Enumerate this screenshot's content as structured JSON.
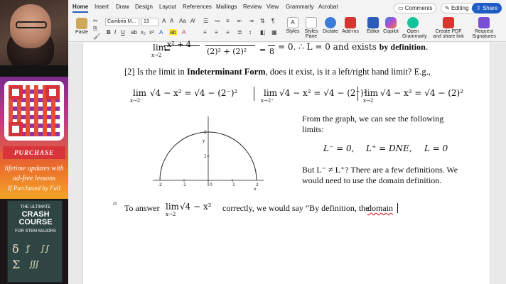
{
  "ribbon": {
    "tabs": [
      "Home",
      "Insert",
      "Draw",
      "Design",
      "Layout",
      "References",
      "Mailings",
      "Review",
      "View",
      "Grammarly",
      "Acrobat"
    ],
    "comments": "Comments",
    "editing": "Editing",
    "share": "Share"
  },
  "toolbar": {
    "paste": "Paste",
    "font_name": "Cambria M...",
    "font_size": "13",
    "styles": "Styles",
    "styles_pane": "Styles Pane",
    "dictate": "Dictate",
    "addins": "Add-ins",
    "editor": "Editor",
    "copilot": "Copilot",
    "grammarly": "Open Grammarly",
    "create_pdf": "Create PDF and share link",
    "request_sig": "Request Signatures"
  },
  "promo": {
    "purchase": "PURCHASE",
    "line1": "lifetime updates with",
    "line2": "ad-free lessons",
    "line3": "If Purchased by Fall",
    "book_top": "THE ULTIMATE",
    "book_main": "CRASH COURSE",
    "book_sub": "FOR STEM MAJORS"
  },
  "document": {
    "top_limit": "lim",
    "top_sub": "x→2",
    "top_fraction_num": "x² + 4",
    "top_fraction_den": "(2)² + (2)²",
    "top_result_den": "8",
    "top_result": "= 0. ∴ L = 0 and exists",
    "top_result_bold": "by definition",
    "top_result_end": ".",
    "q2_prefix": "[2] Is the limit in",
    "q2_bold": "Indeterminant Form",
    "q2_suffix": ", does it exist, is it a left/right hand limit? E.g.,",
    "eq1_sub": "x→2⁻",
    "eq1": "√4 − x² = √4 − (2⁻)²",
    "eq2_sub": "x→2⁺",
    "eq2": "√4 − x² = √4 − (2⁺)²",
    "eq3_sub": "x→2",
    "eq3": "√4 − x² = √4 − (2)²",
    "graph_text_1": "From the graph, we can see the following",
    "graph_text_2": "limits:",
    "limit_left": "L⁻ = 0,",
    "limit_right": "L⁺ = DNE,",
    "limit_both": "L = 0",
    "but_text_1": "But L⁻ ≠ L⁺? There are a few definitions. We",
    "but_text_2": "would need to use the domain definition.",
    "answer_prefix": "To answer",
    "answer_lim": "lim",
    "answer_sub": "x→2",
    "answer_expr": "√4 − x²",
    "answer_middle": "correctly, we would say “By definition, the",
    "answer_last": "domain"
  },
  "graph": {
    "x_ticks": [
      "-2",
      "-1",
      "0",
      "1",
      "2"
    ],
    "y_ticks": [
      "1",
      "2"
    ],
    "x_label": "x",
    "y_label": "y"
  },
  "colors": {
    "accent": "#2b5cb8",
    "share": "#1f5bc4",
    "banner": "#d9343a"
  }
}
